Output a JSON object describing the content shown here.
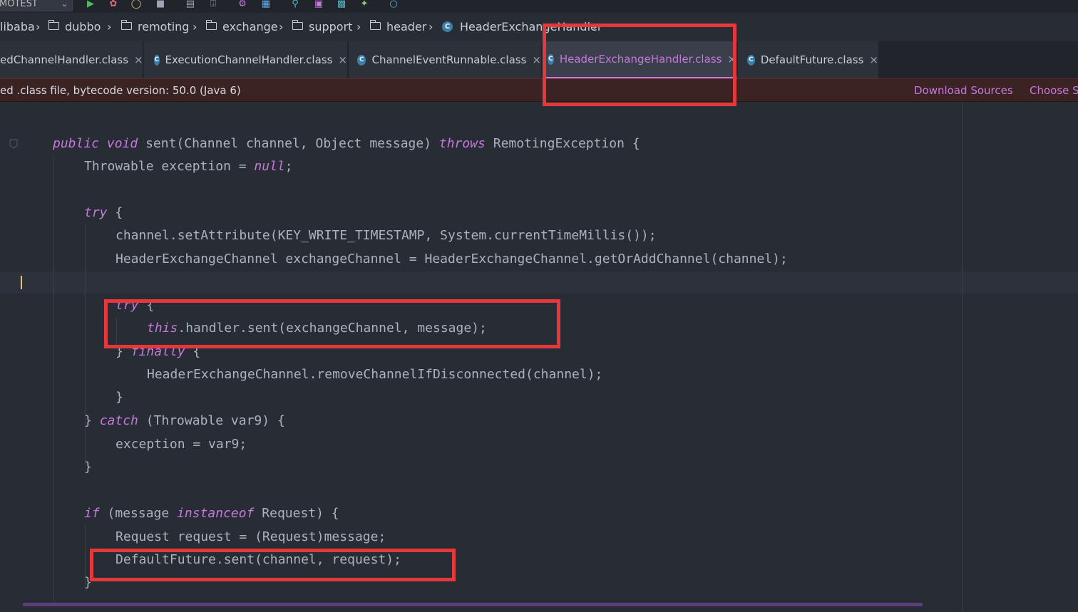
{
  "toolbar": {
    "run_config": "MOTEST",
    "icons": [
      "run-icon",
      "debug-icon",
      "coverage-icon",
      "stop-icon",
      "build-icon",
      "deploy-icon",
      "settings-icon",
      "structure-icon",
      "search-icon",
      "vcs-icon",
      "analyze-icon",
      "plugin-icon",
      "toolbox-icon"
    ]
  },
  "breadcrumb": [
    "libaba",
    "dubbo",
    "remoting",
    "exchange",
    "support",
    "header",
    "HeaderExchangeHandler"
  ],
  "tabs": [
    {
      "label": "edChannelHandler.class",
      "active": false
    },
    {
      "label": "ExecutionChannelHandler.class",
      "active": false
    },
    {
      "label": "ChannelEventRunnable.class",
      "active": false
    },
    {
      "label": "HeaderExchangeHandler.class",
      "active": true
    },
    {
      "label": "DefaultFuture.class",
      "active": false
    }
  ],
  "banner": {
    "message": "ed .class file, bytecode version: 50.0 (Java 6)",
    "download_sources": "Download Sources",
    "choose_sources": "Choose S"
  },
  "code": {
    "l1": [
      "public",
      " ",
      "void",
      " sent(Channel channel, Object message) ",
      "throws",
      " RemotingException {"
    ],
    "l2": [
      "Throwable exception = ",
      "null",
      ";"
    ],
    "l3": [
      "try",
      " {"
    ],
    "l4": "channel.setAttribute(KEY_WRITE_TIMESTAMP, System.currentTimeMillis());",
    "l5": "HeaderExchangeChannel exchangeChannel = HeaderExchangeChannel.getOrAddChannel(channel);",
    "l6": [
      "try",
      " {"
    ],
    "l7": [
      "this",
      ".handler.sent(exchangeChannel, message);"
    ],
    "l8": [
      "} ",
      "finally",
      " {"
    ],
    "l9": "HeaderExchangeChannel.removeChannelIfDisconnected(channel);",
    "l10": "}",
    "l11": [
      "} ",
      "catch",
      " (Throwable var9) {"
    ],
    "l12": "exception = var9;",
    "l13": "}",
    "l14": [
      "if",
      " (message ",
      "instanceof",
      " Request) {"
    ],
    "l15": "Request request = (Request)message;",
    "l16": "DefaultFuture.sent(channel, request);",
    "l17": "}"
  },
  "colors": {
    "keyword": "#c678dd",
    "highlight_box": "#e5383b",
    "active_tab_text": "#c678dd",
    "banner_bg": "#3b2223"
  }
}
